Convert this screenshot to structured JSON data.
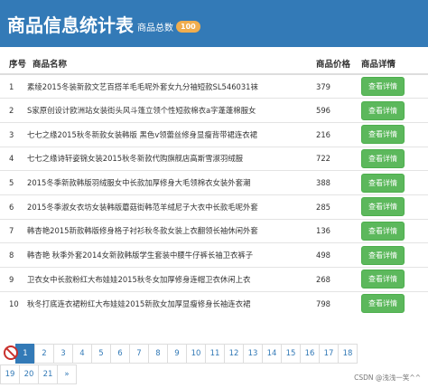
{
  "header": {
    "title": "商品信息统计表",
    "subtitle": "商品总数",
    "count_badge": "100"
  },
  "table": {
    "columns": [
      "序号",
      "商品名称",
      "商品价格",
      "商品详情"
    ],
    "rows": [
      {
        "id": "1",
        "name": "素绫2015冬装新款文艺百搭羊毛毛呢外套女九分袖短款SL546031袜",
        "price": "379",
        "action": "查看详情"
      },
      {
        "id": "2",
        "name": "S家原创设计欧洲站女装街头风斗篷立领个性短款棉衣a字蓬蓬棉服女",
        "price": "596",
        "action": "查看详情"
      },
      {
        "id": "3",
        "name": "七七之缘2015秋冬新款女装韩版 黑色v领蕾丝修身显瘦背带裙连衣裙",
        "price": "216",
        "action": "查看详情"
      },
      {
        "id": "4",
        "name": "七七之缘诗轩姿锦女装2015秋冬新款代购旗舰店高斯雪淑羽绒服",
        "price": "722",
        "action": "查看详情"
      },
      {
        "id": "5",
        "name": "2015冬季新款韩版羽绒服女中长款加厚修身大毛领棉衣女装外套潮",
        "price": "388",
        "action": "查看详情"
      },
      {
        "id": "6",
        "name": "2015冬季淑女衣坊女装韩版蘑菇街韩范羊绒尼子大衣中长款毛呢外套",
        "price": "285",
        "action": "查看详情"
      },
      {
        "id": "7",
        "name": "韩杏艳2015新款韩版修身格子衬衫秋冬款女装上衣翻领长袖休闲外套",
        "price": "136",
        "action": "查看详情"
      },
      {
        "id": "8",
        "name": "韩杏艳 秋季外套2014女新款韩版学生套装中腰牛仔裤长袖卫衣裤子",
        "price": "498",
        "action": "查看详情"
      },
      {
        "id": "9",
        "name": "卫衣女中长款粉红大布娃娃2015秋冬女加厚修身连帽卫衣休闲上衣",
        "price": "268",
        "action": "查看详情"
      },
      {
        "id": "10",
        "name": "秋冬打底连衣裙粉红大布娃娃2015新款女加厚显瘦修身长袖连衣裙",
        "price": "798",
        "action": "查看详情"
      }
    ]
  },
  "pagination": {
    "row1": [
      "1",
      "2",
      "3",
      "4",
      "5",
      "6",
      "7",
      "8",
      "9",
      "10",
      "11",
      "12",
      "13",
      "14",
      "15",
      "16",
      "17",
      "18"
    ],
    "row2": [
      "19",
      "20",
      "21",
      "»"
    ],
    "active_page": "1"
  },
  "watermark": "CSDN @浅浅一笑^^"
}
